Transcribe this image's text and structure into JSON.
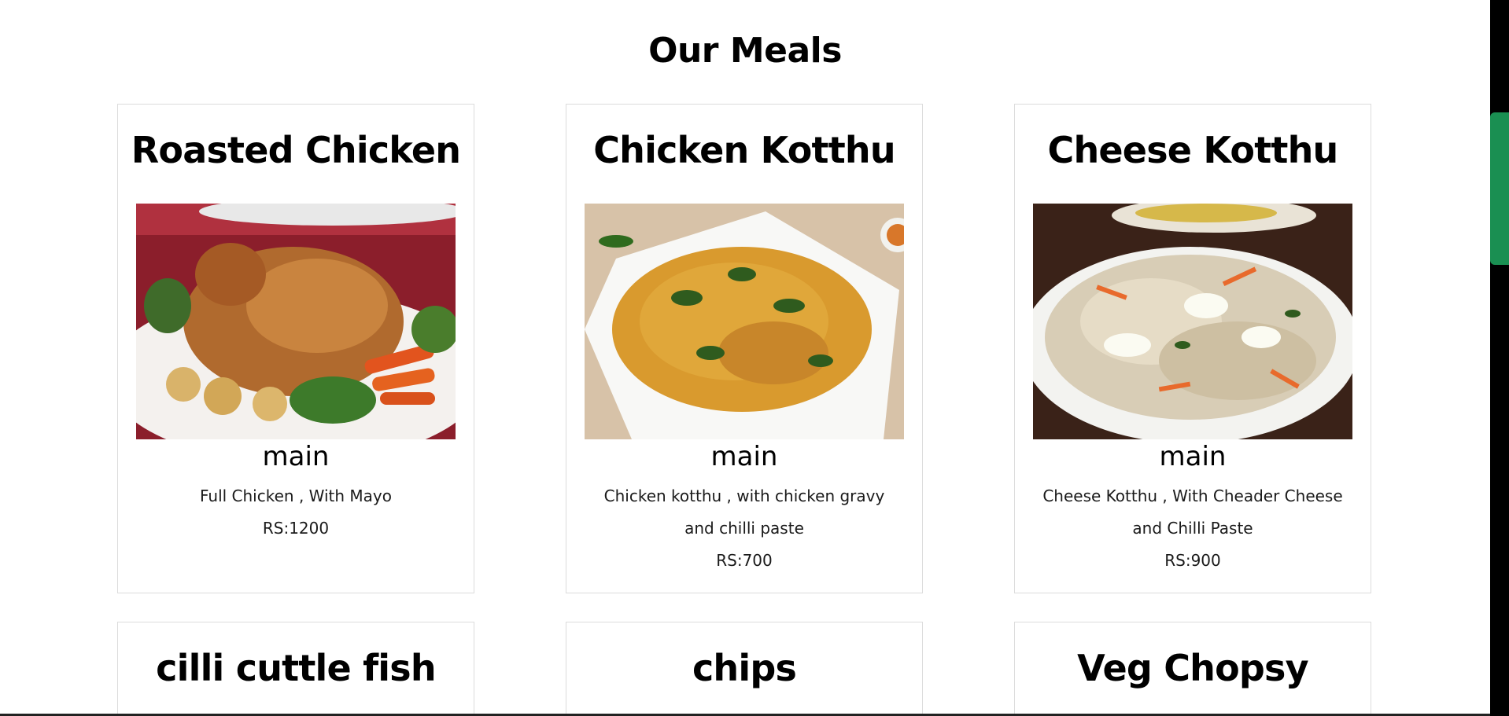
{
  "section": {
    "title": "Our Meals"
  },
  "meals": [
    {
      "name": "Roasted Chicken",
      "category": "main",
      "description": "Full Chicken , With Mayo",
      "price": "RS:1200",
      "image_icon": "roasted-chicken-image"
    },
    {
      "name": "Chicken Kotthu",
      "category": "main",
      "description": "Chicken kotthu , with chicken gravy and chilli paste",
      "price": "RS:700",
      "image_icon": "chicken-kotthu-image"
    },
    {
      "name": "Cheese Kotthu",
      "category": "main",
      "description": "Cheese Kotthu , With Cheader Cheese and Chilli Paste",
      "price": "RS:900",
      "image_icon": "cheese-kotthu-image"
    },
    {
      "name": "cilli cuttle fish"
    },
    {
      "name": "chips"
    },
    {
      "name": "Veg Chopsy"
    }
  ],
  "colors": {
    "scrollbar_track": "#000000",
    "scrollbar_thumb": "#1a8f52",
    "card_border": "#dcdcdc"
  }
}
